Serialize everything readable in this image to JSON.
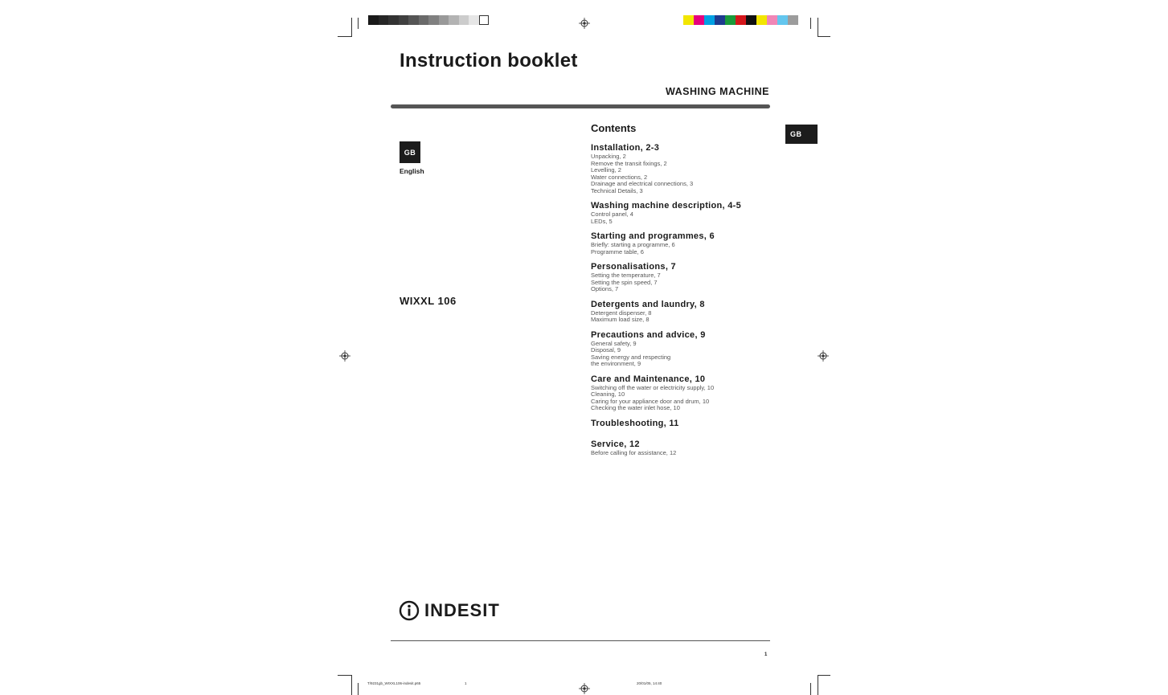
{
  "document": {
    "title": "Instruction booklet",
    "subtitle": "WASHING MACHINE",
    "language_code": "GB",
    "language": "English",
    "model": "WIXXL 106",
    "contents_heading": "Contents",
    "brand": "INDESIT",
    "page_number": "1"
  },
  "toc": [
    {
      "title": "Installation, 2-3",
      "items": [
        "Unpacking, 2",
        "Remove the transit fixings, 2",
        "Levelling, 2",
        "Water connections, 2",
        "Drainage and electrical connections, 3",
        "Technical Details, 3"
      ]
    },
    {
      "title": "Washing machine description, 4-5",
      "items": [
        "Control panel, 4",
        "LEDs, 5"
      ]
    },
    {
      "title": "Starting and programmes, 6",
      "items": [
        "Briefly: starting a programme, 6",
        "Programme table, 6"
      ]
    },
    {
      "title": "Personalisations, 7",
      "items": [
        "Setting the temperature, 7",
        "Setting the spin speed, 7",
        "Options, 7"
      ]
    },
    {
      "title": "Detergents and laundry, 8",
      "items": [
        "Detergent dispenser, 8",
        "Maximum load size, 8"
      ]
    },
    {
      "title": "Precautions and advice, 9",
      "items": [
        "General safety, 9",
        "Disposal, 9",
        "Saving energy and respecting",
        "the environment, 9"
      ]
    },
    {
      "title": "Care and Maintenance, 10",
      "items": [
        "Switching off the water or electricity supply, 10",
        "Cleaning, 10",
        "Caring for your appliance door and drum, 10",
        "Checking the water inlet hose, 10"
      ]
    },
    {
      "title": "Troubleshooting, 11",
      "items": []
    },
    {
      "title": "Service, 12",
      "items": [
        "Before calling for assistance, 12"
      ]
    }
  ],
  "slug": {
    "file": "T/9231gb_WIXXL106-indesit.p65",
    "page": "1",
    "date": "20/01/05, 14:40"
  },
  "colors": {
    "grayscale": [
      "#1a1a1a",
      "#262626",
      "#333333",
      "#404040",
      "#555555",
      "#6a6a6a",
      "#808080",
      "#999999",
      "#b3b3b3",
      "#cccccc",
      "#e6e6e6",
      "#ffffff"
    ],
    "process": [
      "#f2e600",
      "#e6007e",
      "#00a0e3",
      "#1f3b8f",
      "#1a9a3a",
      "#d4161b",
      "#111111",
      "#f2e600",
      "#f086b6",
      "#63c6ee",
      "#9c9c9c"
    ]
  }
}
